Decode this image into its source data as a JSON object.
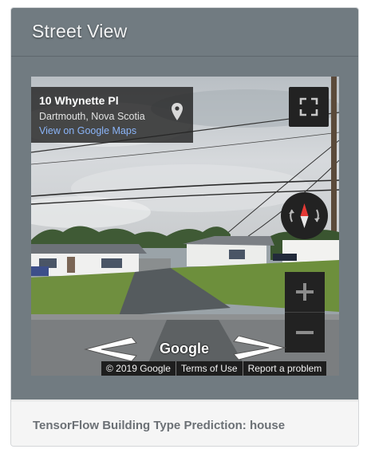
{
  "card": {
    "title": "Street View"
  },
  "streetview": {
    "address_title": "10 Whynette Pl",
    "address_sub": "Dartmouth, Nova Scotia",
    "maps_link": "View on Google Maps",
    "logo": "Google",
    "attribution": {
      "copyright": "© 2019 Google",
      "terms": "Terms of Use",
      "report": "Report a problem"
    },
    "controls": {
      "fullscreen_icon": "fullscreen-icon",
      "compass_icon": "compass-icon",
      "zoom_in_icon": "plus-icon",
      "zoom_out_icon": "minus-icon",
      "pin_icon": "map-pin-icon",
      "nav_arrows": [
        "arrow-left-icon",
        "arrow-right-icon"
      ]
    }
  },
  "footer": {
    "prediction": "TensorFlow Building Type Prediction: house"
  },
  "colors": {
    "header_bg": "#717b81",
    "link": "#8ab4f8",
    "compass_north": "#e53935"
  }
}
